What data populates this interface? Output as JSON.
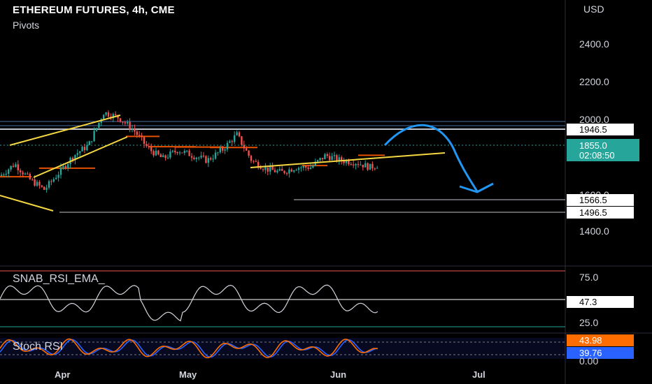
{
  "header": {
    "title": "ETHEREUM FUTURES, 4h, CME",
    "indicator": "Pivots"
  },
  "axis": {
    "currency": "USD",
    "price_ticks": [
      "2400.0",
      "2200.0",
      "2000.0",
      "1600.0",
      "1400.0"
    ],
    "rsi_ticks": [
      "75.0",
      "25.0"
    ],
    "stoch_ticks": [
      "0.00"
    ],
    "date_ticks": [
      "Apr",
      "May",
      "Jun",
      "Jul"
    ]
  },
  "price_tags": {
    "resistance": "1946.5",
    "current_price": "1855.0",
    "countdown": "02:08:50",
    "support_1": "1566.5",
    "support_2": "1496.5"
  },
  "oscillators": {
    "rsi_name": "SNAB_RSI_EMA_",
    "rsi_value": "47.3",
    "stoch_name": "Stoch RSI",
    "stoch_k": "43.98",
    "stoch_d": "39.76"
  },
  "colors": {
    "background": "#000000",
    "bull": "#26a69a",
    "bear": "#ef5350",
    "trendline": "#f5d742",
    "pivot": "#e65100",
    "forecast_arrow": "#2196f3",
    "current_price_tag": "#26a69a",
    "stoch_k": "#ff6d00",
    "stoch_d": "#2962ff"
  },
  "chart_data": {
    "type": "candlestick",
    "symbol": "ETHEREUM FUTURES",
    "timeframe": "4h",
    "exchange": "CME",
    "price_range": [
      1300,
      2560
    ],
    "price_path": [
      [
        "03-15",
        1780
      ],
      [
        "03-18",
        1850
      ],
      [
        "03-21",
        1760
      ],
      [
        "03-24",
        1700
      ],
      [
        "03-27",
        1800
      ],
      [
        "03-30",
        1900
      ],
      [
        "04-02",
        1960
      ],
      [
        "04-05",
        2150
      ],
      [
        "04-07",
        2120
      ],
      [
        "04-09",
        2050
      ],
      [
        "04-11",
        1940
      ],
      [
        "04-14",
        1880
      ],
      [
        "04-18",
        1930
      ],
      [
        "04-22",
        1900
      ],
      [
        "04-26",
        1870
      ],
      [
        "04-30",
        1930
      ],
      [
        "05-04",
        2020
      ],
      [
        "05-07",
        1870
      ],
      [
        "05-11",
        1820
      ],
      [
        "05-14",
        1800
      ],
      [
        "05-18",
        1830
      ],
      [
        "05-22",
        1830
      ],
      [
        "05-26",
        1900
      ],
      [
        "05-29",
        1870
      ],
      [
        "06-01",
        1860
      ],
      [
        "06-05",
        1830
      ],
      [
        "06-08",
        1855
      ]
    ],
    "levels": [
      {
        "label": "1946.5",
        "value": 1946.5
      },
      {
        "label": "1566.5",
        "value": 1566.5
      },
      {
        "label": "1496.5",
        "value": 1496.5
      }
    ],
    "current_price": 1855.0,
    "rsi_last": 47.3,
    "stoch_rsi_last": {
      "k": 43.98,
      "d": 39.76
    }
  }
}
